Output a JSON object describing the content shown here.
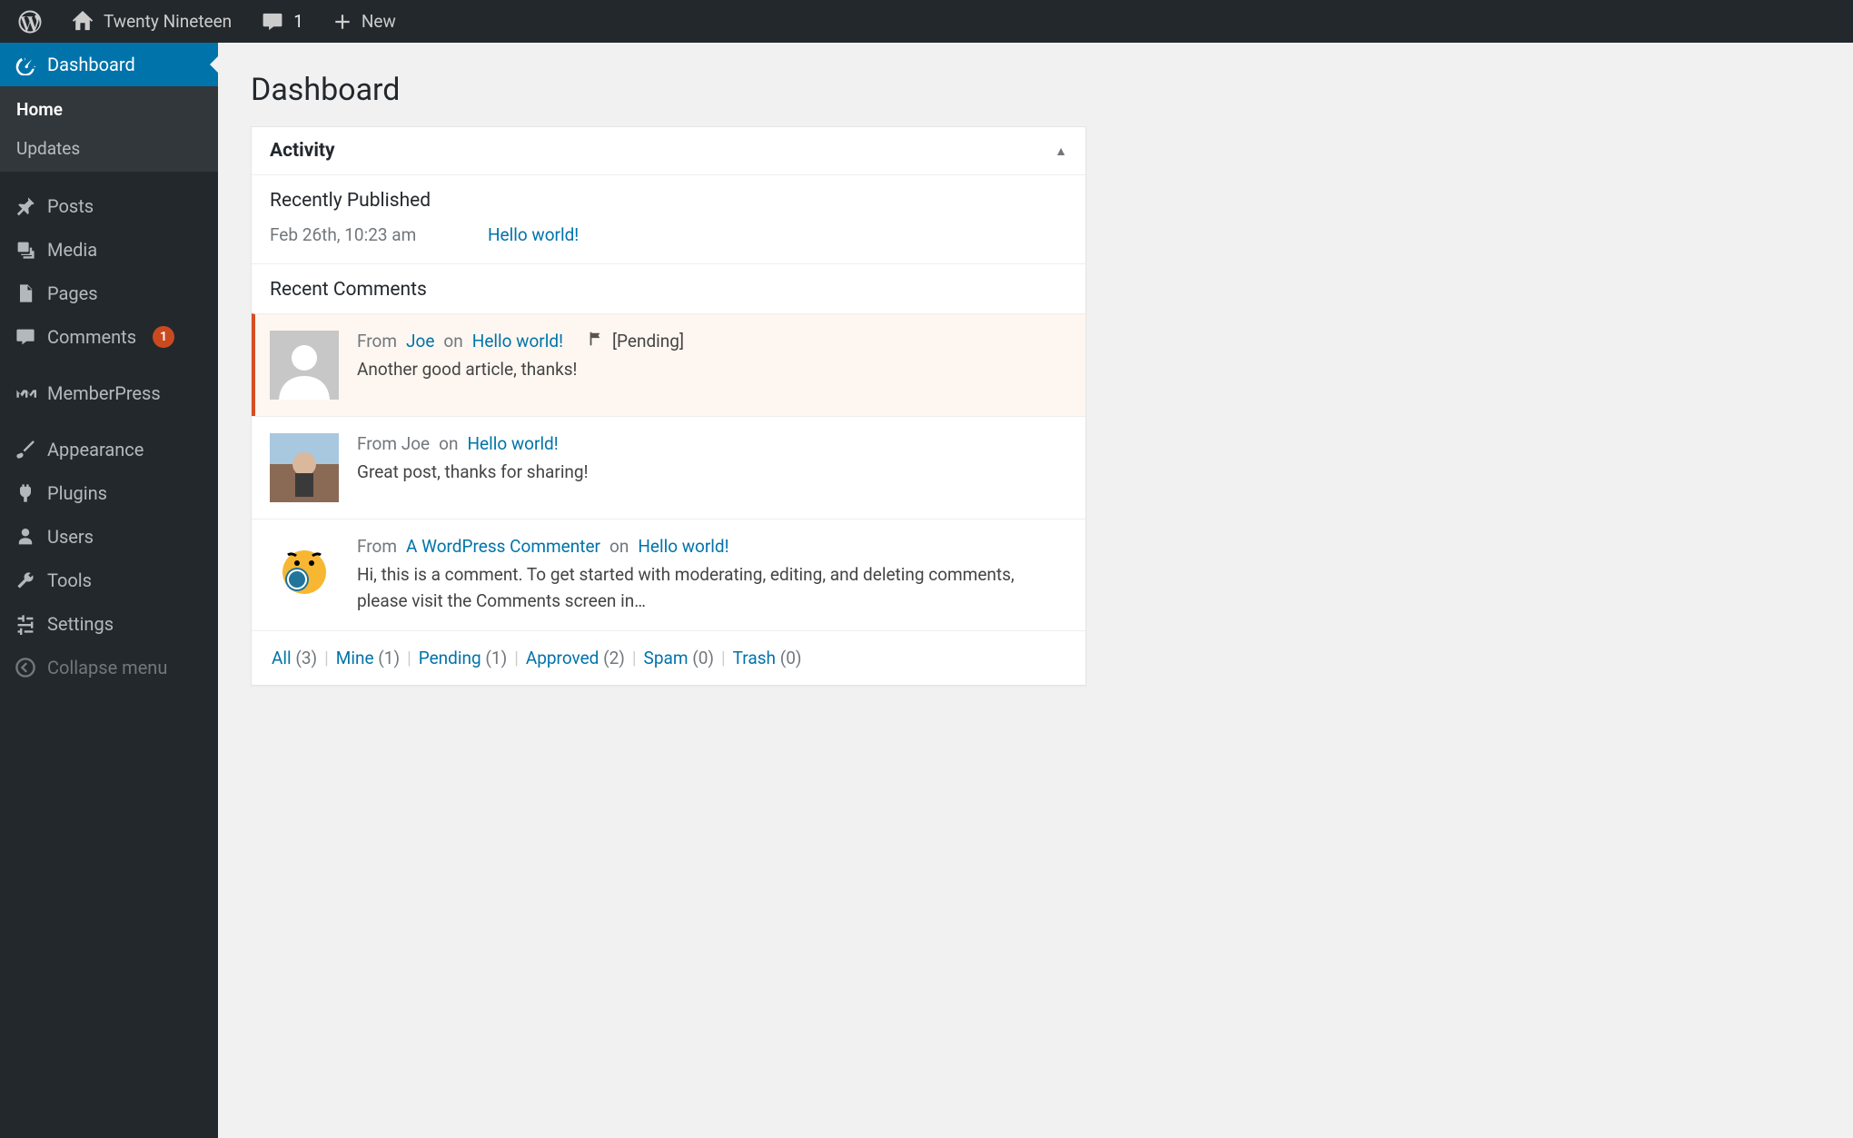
{
  "adminbar": {
    "site_name": "Twenty Nineteen",
    "comment_count": "1",
    "new_label": "New"
  },
  "sidebar": {
    "items": [
      {
        "id": "dashboard",
        "label": "Dashboard",
        "active": true
      },
      {
        "id": "posts",
        "label": "Posts"
      },
      {
        "id": "media",
        "label": "Media"
      },
      {
        "id": "pages",
        "label": "Pages"
      },
      {
        "id": "comments",
        "label": "Comments",
        "badge": "1"
      },
      {
        "id": "memberpress",
        "label": "MemberPress"
      },
      {
        "id": "appearance",
        "label": "Appearance"
      },
      {
        "id": "plugins",
        "label": "Plugins"
      },
      {
        "id": "users",
        "label": "Users"
      },
      {
        "id": "tools",
        "label": "Tools"
      },
      {
        "id": "settings",
        "label": "Settings"
      }
    ],
    "dashboard_sub": {
      "home": "Home",
      "updates": "Updates"
    },
    "collapse_label": "Collapse menu"
  },
  "page": {
    "title": "Dashboard"
  },
  "activity": {
    "title": "Activity",
    "recently_published_title": "Recently Published",
    "published": {
      "date": "Feb 26th, 10:23 am",
      "post_title": "Hello world!"
    },
    "recent_comments_title": "Recent Comments",
    "pending_label": "[Pending]",
    "comments": [
      {
        "from_prefix": "From",
        "author": "Joe",
        "author_link": true,
        "on_word": "on",
        "post": "Hello world!",
        "pending": true,
        "body": "Another good article, thanks!",
        "avatar": "mystery"
      },
      {
        "from_prefix": "From Joe",
        "author": "",
        "author_link": false,
        "on_word": "on",
        "post": "Hello world!",
        "pending": false,
        "body": "Great post, thanks for sharing!",
        "avatar": "photo"
      },
      {
        "from_prefix": "From",
        "author": "A WordPress Commenter",
        "author_link": true,
        "on_word": "on",
        "post": "Hello world!",
        "pending": false,
        "body": "Hi, this is a comment. To get started with moderating, editing, and deleting comments, please visit the Comments screen in…",
        "avatar": "wapuu"
      }
    ],
    "filters": [
      {
        "label": "All",
        "count": "(3)"
      },
      {
        "label": "Mine",
        "count": "(1)"
      },
      {
        "label": "Pending",
        "count": "(1)"
      },
      {
        "label": "Approved",
        "count": "(2)"
      },
      {
        "label": "Spam",
        "count": "(0)"
      },
      {
        "label": "Trash",
        "count": "(0)"
      }
    ]
  }
}
